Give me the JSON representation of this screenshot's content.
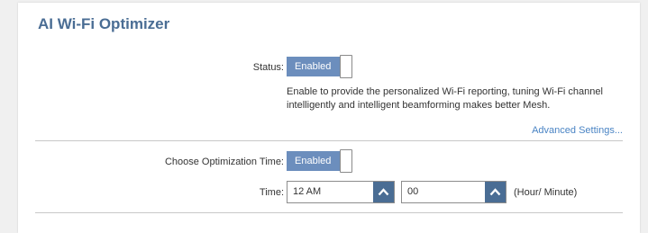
{
  "panel": {
    "title": "AI Wi-Fi Optimizer"
  },
  "status": {
    "label": "Status:",
    "toggle_label": "Enabled",
    "enabled": true,
    "description": "Enable to provide the personalized Wi-Fi reporting, tuning Wi-Fi channel intelligently and intelligent beamforming makes better Mesh."
  },
  "advanced_link": "Advanced Settings...",
  "optimization_time": {
    "label": "Choose Optimization Time:",
    "toggle_label": "Enabled",
    "enabled": true
  },
  "time": {
    "label": "Time:",
    "hour_value": "12 AM",
    "minute_value": "00",
    "hint": "(Hour/ Minute)",
    "hour_button_icon": "chevron-up-icon",
    "minute_button_icon": "chevron-up-icon"
  },
  "colors": {
    "title": "#4a6d94",
    "toggle_on": "#6c8ebd",
    "select_button": "#4a6d94",
    "link": "#4a84c4"
  }
}
